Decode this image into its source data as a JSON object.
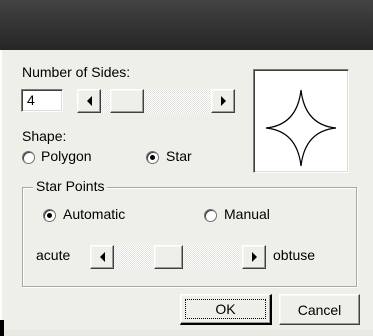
{
  "dialog": {
    "sides_label": "Number of Sides:",
    "sides_value": "4",
    "shape_label": "Shape:",
    "shape_options": [
      "Polygon",
      "Star"
    ],
    "shape_selected": "Star",
    "star_points_label": "Star Points",
    "star_points_options": [
      "Automatic",
      "Manual"
    ],
    "star_points_selected": "Automatic",
    "acute_label": "acute",
    "obtuse_label": "obtuse",
    "ok_label": "OK",
    "cancel_label": "Cancel",
    "sides_slider_level": 0.1,
    "sharpness_slider_level": 0.5
  }
}
